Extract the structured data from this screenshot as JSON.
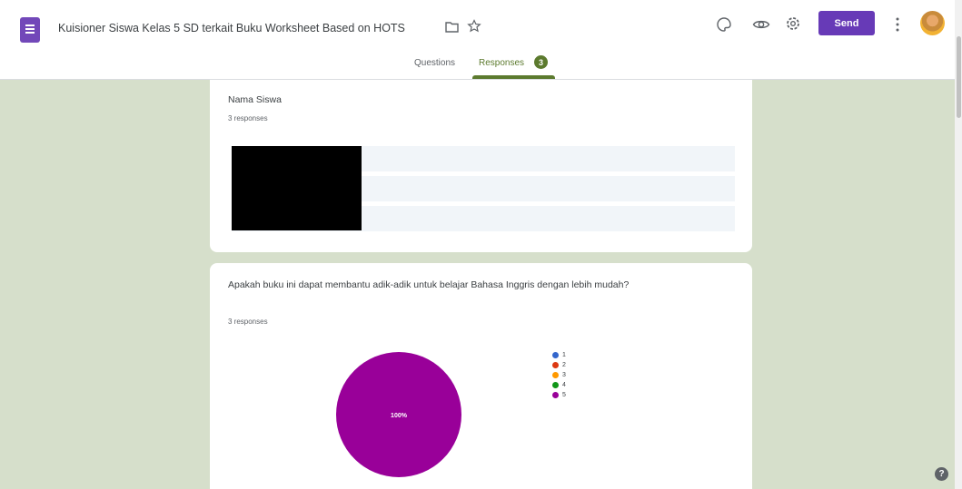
{
  "header": {
    "title": "Kuisioner Siswa Kelas 5 SD terkait Buku Worksheet  Based on HOTS",
    "send_label": "Send",
    "accent_color": "#673ab7"
  },
  "tabs": [
    {
      "label": "Questions"
    },
    {
      "label": "Responses",
      "badge": "3"
    }
  ],
  "icons": [
    "forms-logo-icon",
    "folder-icon",
    "star-icon",
    "palette-icon",
    "eye-icon",
    "settings-icon",
    "more-vert-icon",
    "help-icon"
  ],
  "cards": [
    {
      "title": "Nama Siswa",
      "count": "3 responses"
    },
    {
      "title": "Apakah buku ini dapat membantu adik-adik untuk belajar Bahasa Inggris dengan lebih mudah?",
      "count": "3 responses"
    }
  ],
  "chart_data": {
    "type": "pie",
    "slice_label": "100%",
    "legend": [
      "1",
      "2",
      "3",
      "4",
      "5"
    ],
    "colors": [
      "#3366cc",
      "#dc3912",
      "#ff9900",
      "#109618",
      "#990099"
    ],
    "values": [
      0,
      0,
      0,
      0,
      100
    ]
  }
}
